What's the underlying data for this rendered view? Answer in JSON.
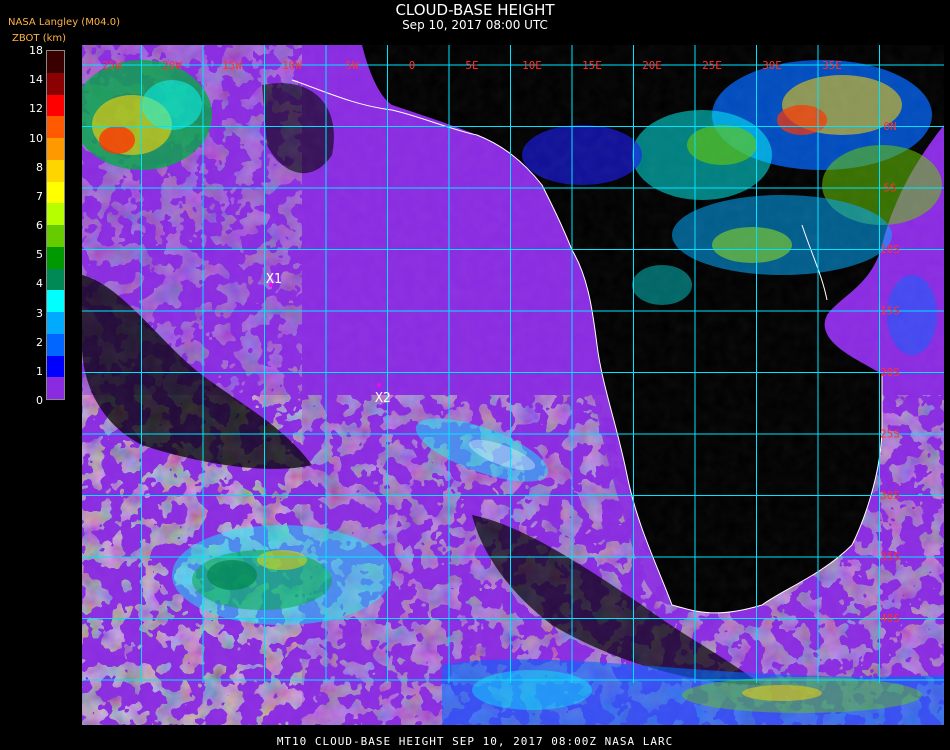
{
  "header": {
    "title": "CLOUD-BASE HEIGHT",
    "subtitle": "Sep 10, 2017 08:00 UTC",
    "source": "NASA Langley (M04.0)",
    "units": "ZBOT (km)"
  },
  "legend": {
    "ticks": [
      "18",
      "14",
      "12",
      "10",
      "8",
      "7",
      "6",
      "5",
      "4",
      "3",
      "2",
      "1",
      "0"
    ],
    "colors": [
      "#3a0000",
      "#8b0000",
      "#ff0000",
      "#ff5a00",
      "#ff9900",
      "#ffd500",
      "#ffff00",
      "#b5ff00",
      "#66cc00",
      "#009900",
      "#008855",
      "#00ffff",
      "#00aaff",
      "#0066ff",
      "#0000ff",
      "#8a2be2"
    ]
  },
  "map": {
    "lon_labels": [
      "25W",
      "20W",
      "15W",
      "10W",
      "5W",
      "0",
      "5E",
      "10E",
      "15E",
      "20E",
      "25E",
      "30E",
      "35E"
    ],
    "lat_labels": [
      "0N",
      "5S",
      "10S",
      "15S",
      "20S",
      "25S",
      "30S",
      "35S",
      "40S"
    ],
    "markers": [
      {
        "label": "X1"
      },
      {
        "label": "X2"
      }
    ],
    "colors": {
      "clear": "#000000",
      "low_cloud": "#8a2be2",
      "grid": "#00e5ff",
      "coast": "#ffffff",
      "lat_label": "#ff3030",
      "lon_label": "#ff3030"
    }
  },
  "footer": {
    "text": "MT10   CLOUD-BASE HEIGHT   SEP 10, 2017 08:00Z   NASA LARC"
  }
}
